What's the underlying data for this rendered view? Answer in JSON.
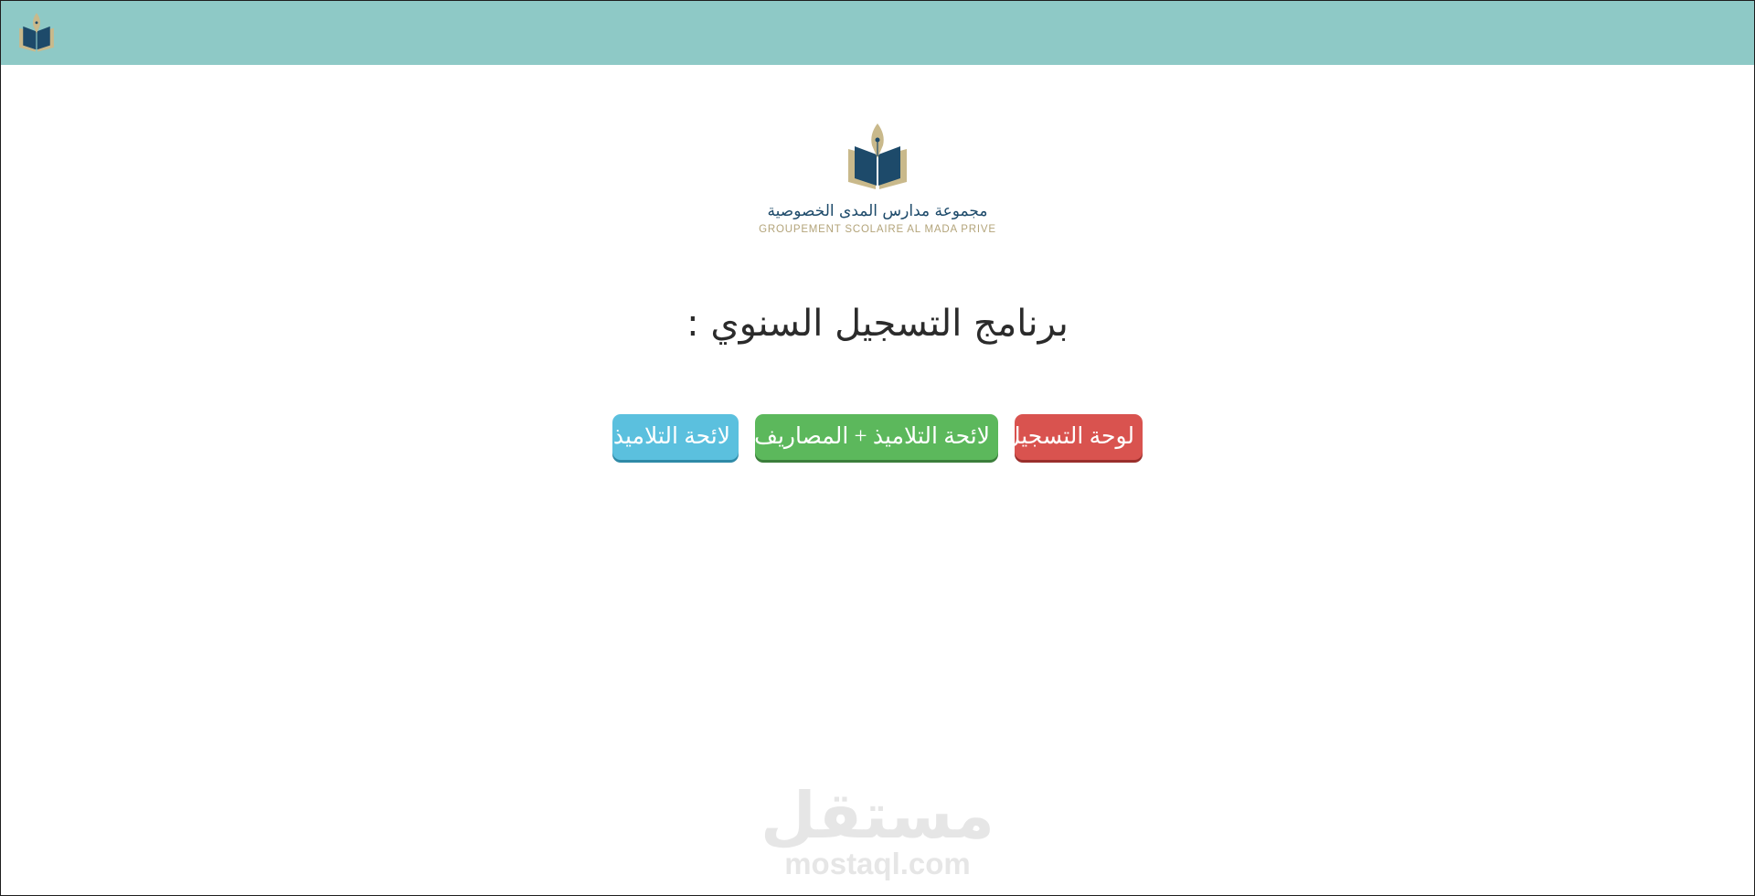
{
  "brand": {
    "arabic_name": "مجموعة مدارس المدى الخصوصية",
    "french_name": "GROUPEMENT SCOLAIRE AL MADA PRIVE",
    "colors": {
      "topbar": "#8ec9c6",
      "navy": "#1d4a6a",
      "gold": "#b3a47a"
    }
  },
  "main": {
    "title": "برنامج التسجيل السنوي :"
  },
  "buttons": [
    {
      "label": "لوحة التسجيل",
      "color": "#d9534f"
    },
    {
      "label": "لائحة التلاميذ + المصاريف",
      "color": "#5cb85c"
    },
    {
      "label": "لائحة التلاميذ",
      "color": "#5bc0de"
    }
  ],
  "watermark": {
    "arabic": "مستقل",
    "latin": "mostaql.com"
  },
  "icons": {
    "logo": "book-pen-emblem-icon"
  }
}
